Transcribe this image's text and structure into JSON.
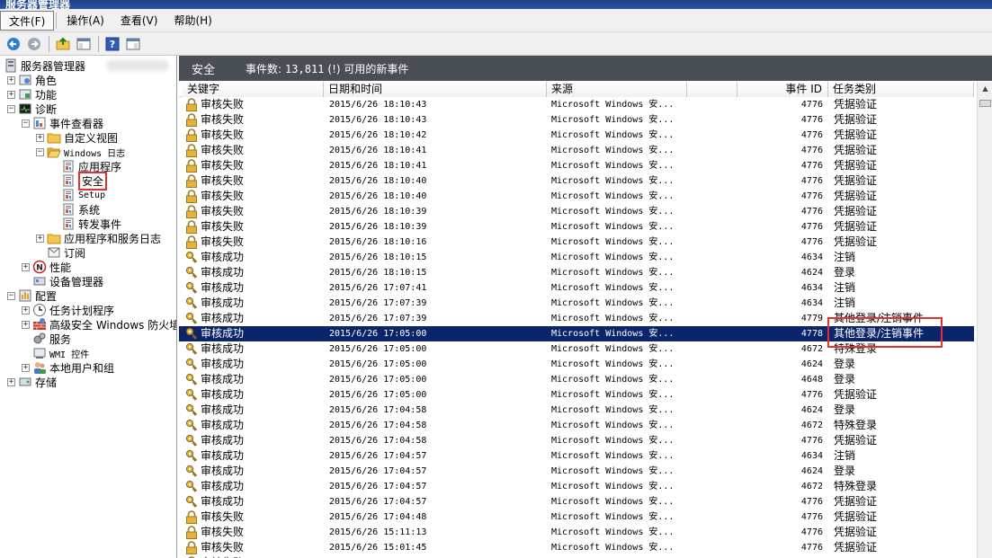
{
  "window": {
    "title": "服务器管理器"
  },
  "menu": [
    {
      "label": "文件(F)",
      "active": true
    },
    {
      "label": "操作(A)"
    },
    {
      "label": "查看(V)"
    },
    {
      "label": "帮助(H)"
    }
  ],
  "toolbar": [
    {
      "name": "back-icon"
    },
    {
      "name": "forward-icon"
    },
    {
      "sep": true
    },
    {
      "name": "up-folder-icon"
    },
    {
      "name": "show-hide-tree-icon"
    },
    {
      "sep": true
    },
    {
      "name": "help-icon"
    },
    {
      "name": "action-pane-icon"
    }
  ],
  "tree": [
    {
      "label": "服务器管理器",
      "level": 0,
      "icon": "server-manager-icon",
      "expander": ""
    },
    {
      "label": "",
      "level": 0,
      "blurred": true,
      "inline": true
    },
    {
      "label": "角色",
      "level": 1,
      "icon": "roles-icon",
      "expander": "+"
    },
    {
      "label": "功能",
      "level": 1,
      "icon": "features-icon",
      "expander": "+"
    },
    {
      "label": "诊断",
      "level": 1,
      "icon": "diagnostics-icon",
      "expander": "-"
    },
    {
      "label": "事件查看器",
      "level": 2,
      "icon": "event-viewer-icon",
      "expander": "-"
    },
    {
      "label": "自定义视图",
      "level": 3,
      "icon": "folder-icon",
      "expander": "+"
    },
    {
      "label": "Windows 日志",
      "level": 3,
      "icon": "folder-open-icon",
      "expander": "-",
      "small": true
    },
    {
      "label": "应用程序",
      "level": 4,
      "icon": "log-icon"
    },
    {
      "label": "安全",
      "level": 4,
      "icon": "log-icon",
      "selected": true
    },
    {
      "label": "Setup",
      "level": 4,
      "icon": "log-icon",
      "small": true
    },
    {
      "label": "系统",
      "level": 4,
      "icon": "log-icon"
    },
    {
      "label": "转发事件",
      "level": 4,
      "icon": "log-icon"
    },
    {
      "label": "应用程序和服务日志",
      "level": 3,
      "icon": "folder-icon",
      "expander": "+"
    },
    {
      "label": "订阅",
      "level": 3,
      "icon": "subscriptions-icon"
    },
    {
      "label": "性能",
      "level": 2,
      "icon": "performance-icon",
      "expander": "+"
    },
    {
      "label": "设备管理器",
      "level": 2,
      "icon": "device-manager-icon"
    },
    {
      "label": "配置",
      "level": 1,
      "icon": "configuration-icon",
      "expander": "-"
    },
    {
      "label": "任务计划程序",
      "level": 2,
      "icon": "task-scheduler-icon",
      "expander": "+"
    },
    {
      "label": "高级安全 Windows 防火墙",
      "level": 2,
      "icon": "firewall-icon",
      "expander": "+"
    },
    {
      "label": "服务",
      "level": 2,
      "icon": "services-icon"
    },
    {
      "label": "WMI 控件",
      "level": 2,
      "icon": "wmi-icon",
      "small": true
    },
    {
      "label": "本地用户和组",
      "level": 2,
      "icon": "users-icon",
      "expander": "+"
    },
    {
      "label": "存储",
      "level": 1,
      "icon": "storage-icon",
      "expander": "+"
    }
  ],
  "pane": {
    "title": "安全",
    "count_label": "事件数:",
    "count": "13,811",
    "notice": "(!) 可用的新事件"
  },
  "columns": [
    "关键字",
    "日期和时间",
    "来源",
    "事件 ID",
    "任务类别"
  ],
  "rows": [
    {
      "kw": "审核失败",
      "type": "fail",
      "dt": "2015/6/26 18:10:43",
      "src": "Microsoft Windows 安...",
      "id": "4776",
      "cat": "凭据验证"
    },
    {
      "kw": "审核失败",
      "type": "fail",
      "dt": "2015/6/26 18:10:43",
      "src": "Microsoft Windows 安...",
      "id": "4776",
      "cat": "凭据验证"
    },
    {
      "kw": "审核失败",
      "type": "fail",
      "dt": "2015/6/26 18:10:42",
      "src": "Microsoft Windows 安...",
      "id": "4776",
      "cat": "凭据验证"
    },
    {
      "kw": "审核失败",
      "type": "fail",
      "dt": "2015/6/26 18:10:41",
      "src": "Microsoft Windows 安...",
      "id": "4776",
      "cat": "凭据验证"
    },
    {
      "kw": "审核失败",
      "type": "fail",
      "dt": "2015/6/26 18:10:41",
      "src": "Microsoft Windows 安...",
      "id": "4776",
      "cat": "凭据验证"
    },
    {
      "kw": "审核失败",
      "type": "fail",
      "dt": "2015/6/26 18:10:40",
      "src": "Microsoft Windows 安...",
      "id": "4776",
      "cat": "凭据验证"
    },
    {
      "kw": "审核失败",
      "type": "fail",
      "dt": "2015/6/26 18:10:40",
      "src": "Microsoft Windows 安...",
      "id": "4776",
      "cat": "凭据验证"
    },
    {
      "kw": "审核失败",
      "type": "fail",
      "dt": "2015/6/26 18:10:39",
      "src": "Microsoft Windows 安...",
      "id": "4776",
      "cat": "凭据验证"
    },
    {
      "kw": "审核失败",
      "type": "fail",
      "dt": "2015/6/26 18:10:39",
      "src": "Microsoft Windows 安...",
      "id": "4776",
      "cat": "凭据验证"
    },
    {
      "kw": "审核失败",
      "type": "fail",
      "dt": "2015/6/26 18:10:16",
      "src": "Microsoft Windows 安...",
      "id": "4776",
      "cat": "凭据验证"
    },
    {
      "kw": "审核成功",
      "type": "ok",
      "dt": "2015/6/26 18:10:15",
      "src": "Microsoft Windows 安...",
      "id": "4634",
      "cat": "注销"
    },
    {
      "kw": "审核成功",
      "type": "ok",
      "dt": "2015/6/26 18:10:15",
      "src": "Microsoft Windows 安...",
      "id": "4624",
      "cat": "登录"
    },
    {
      "kw": "审核成功",
      "type": "ok",
      "dt": "2015/6/26 17:07:41",
      "src": "Microsoft Windows 安...",
      "id": "4634",
      "cat": "注销"
    },
    {
      "kw": "审核成功",
      "type": "ok",
      "dt": "2015/6/26 17:07:39",
      "src": "Microsoft Windows 安...",
      "id": "4634",
      "cat": "注销"
    },
    {
      "kw": "审核成功",
      "type": "ok",
      "dt": "2015/6/26 17:07:39",
      "src": "Microsoft Windows 安...",
      "id": "4779",
      "cat": "其他登录/注销事件"
    },
    {
      "kw": "审核成功",
      "type": "ok",
      "dt": "2015/6/26 17:05:00",
      "src": "Microsoft Windows 安...",
      "id": "4778",
      "cat": "其他登录/注销事件",
      "selected": true
    },
    {
      "kw": "审核成功",
      "type": "ok",
      "dt": "2015/6/26 17:05:00",
      "src": "Microsoft Windows 安...",
      "id": "4672",
      "cat": "特殊登录"
    },
    {
      "kw": "审核成功",
      "type": "ok",
      "dt": "2015/6/26 17:05:00",
      "src": "Microsoft Windows 安...",
      "id": "4624",
      "cat": "登录"
    },
    {
      "kw": "审核成功",
      "type": "ok",
      "dt": "2015/6/26 17:05:00",
      "src": "Microsoft Windows 安...",
      "id": "4648",
      "cat": "登录"
    },
    {
      "kw": "审核成功",
      "type": "ok",
      "dt": "2015/6/26 17:05:00",
      "src": "Microsoft Windows 安...",
      "id": "4776",
      "cat": "凭据验证"
    },
    {
      "kw": "审核成功",
      "type": "ok",
      "dt": "2015/6/26 17:04:58",
      "src": "Microsoft Windows 安...",
      "id": "4624",
      "cat": "登录"
    },
    {
      "kw": "审核成功",
      "type": "ok",
      "dt": "2015/6/26 17:04:58",
      "src": "Microsoft Windows 安...",
      "id": "4672",
      "cat": "特殊登录"
    },
    {
      "kw": "审核成功",
      "type": "ok",
      "dt": "2015/6/26 17:04:58",
      "src": "Microsoft Windows 安...",
      "id": "4776",
      "cat": "凭据验证"
    },
    {
      "kw": "审核成功",
      "type": "ok",
      "dt": "2015/6/26 17:04:57",
      "src": "Microsoft Windows 安...",
      "id": "4634",
      "cat": "注销"
    },
    {
      "kw": "审核成功",
      "type": "ok",
      "dt": "2015/6/26 17:04:57",
      "src": "Microsoft Windows 安...",
      "id": "4624",
      "cat": "登录"
    },
    {
      "kw": "审核成功",
      "type": "ok",
      "dt": "2015/6/26 17:04:57",
      "src": "Microsoft Windows 安...",
      "id": "4672",
      "cat": "特殊登录"
    },
    {
      "kw": "审核成功",
      "type": "ok",
      "dt": "2015/6/26 17:04:57",
      "src": "Microsoft Windows 安...",
      "id": "4776",
      "cat": "凭据验证"
    },
    {
      "kw": "审核失败",
      "type": "fail",
      "dt": "2015/6/26 17:04:48",
      "src": "Microsoft Windows 安...",
      "id": "4776",
      "cat": "凭据验证"
    },
    {
      "kw": "审核失败",
      "type": "fail",
      "dt": "2015/6/26 15:11:13",
      "src": "Microsoft Windows 安...",
      "id": "4776",
      "cat": "凭据验证"
    },
    {
      "kw": "审核失败",
      "type": "fail",
      "dt": "2015/6/26 15:01:45",
      "src": "Microsoft Windows 安...",
      "id": "4776",
      "cat": "凭据验证"
    },
    {
      "kw": "审核失败",
      "type": "fail",
      "dt": "",
      "src": "",
      "id": "",
      "cat": "",
      "partial": true
    }
  ],
  "colors": {
    "header_bg": "#4a4e55",
    "selection": "#0b246a",
    "annotation": "#e03030",
    "lock": "#e8b23a",
    "key": "#d4a030"
  }
}
